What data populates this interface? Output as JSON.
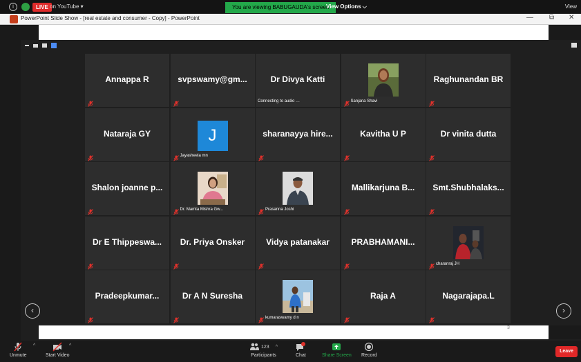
{
  "top_bar": {
    "live_badge": "LIVE",
    "youtube_text": "on YouTube ▾",
    "banner": "You are viewing BABUGAUDA's screen",
    "view_options": "View Options ⌵",
    "view_button": "View"
  },
  "window": {
    "title": "PowerPoint Slide Show - [real estate and consumer - Copy] - PowerPoint",
    "minimize": "—",
    "restore": "⧉",
    "close": "✕"
  },
  "colors": {
    "tile_bg": "#2d2d2d",
    "muted_red": "#e0312b",
    "banner_green": "#23a84a",
    "leave_red": "#e02828",
    "share_green": "#23a84a"
  },
  "participants": [
    {
      "name": "Annappa R",
      "label": "",
      "photo": ""
    },
    {
      "name": "svpswamy@gm...",
      "label": "",
      "photo": ""
    },
    {
      "name": "Dr Divya Katti",
      "label": "Connecting to audio …",
      "photo": ""
    },
    {
      "name": "",
      "label": "Sanjana Shavi",
      "photo": "woman-photo"
    },
    {
      "name": "Raghunandan BR",
      "label": "",
      "photo": ""
    },
    {
      "name": "Nataraja GY",
      "label": "",
      "photo": ""
    },
    {
      "name": "",
      "label": "Jayasheela mn",
      "photo": "avatar-J",
      "avatar_letter": "J"
    },
    {
      "name": "sharanayya hire...",
      "label": "",
      "photo": ""
    },
    {
      "name": "Kavitha U P",
      "label": "",
      "photo": ""
    },
    {
      "name": "Dr vinita dutta",
      "label": "",
      "photo": ""
    },
    {
      "name": "Shalon joanne p...",
      "label": "",
      "photo": ""
    },
    {
      "name": "",
      "label": "Dr. Mamta Mishra Gw...",
      "photo": "woman-office-photo"
    },
    {
      "name": "",
      "label": "Prasanna Joshi",
      "photo": "man-photo"
    },
    {
      "name": "Mallikarjuna B...",
      "label": "",
      "photo": ""
    },
    {
      "name": "Smt.Shubhalaks...",
      "label": "",
      "photo": ""
    },
    {
      "name": "Dr E Thippeswa...",
      "label": "",
      "photo": ""
    },
    {
      "name": "Dr. Priya Onsker",
      "label": "",
      "photo": ""
    },
    {
      "name": "Vidya patanakar",
      "label": "",
      "photo": ""
    },
    {
      "name": "PRABHAMANI...",
      "label": "",
      "photo": ""
    },
    {
      "name": "",
      "label": "charanraj JH",
      "photo": "man-red-photo"
    },
    {
      "name": "Pradeepkumar...",
      "label": "",
      "photo": ""
    },
    {
      "name": "Dr A N Suresha",
      "label": "",
      "photo": ""
    },
    {
      "name": "",
      "label": "kumaraswamy d n",
      "photo": "man-outdoor-photo"
    },
    {
      "name": "Raja A",
      "label": "",
      "photo": ""
    },
    {
      "name": "Nagarajapa.L",
      "label": "",
      "photo": ""
    }
  ],
  "slide_number": "3",
  "toolbar": {
    "unmute": "Unmute",
    "start_video": "Start Video",
    "participants": "Participants",
    "participant_count": "123",
    "chat": "Chat",
    "share_screen": "Share Screen",
    "record": "Record",
    "leave": "Leave"
  }
}
